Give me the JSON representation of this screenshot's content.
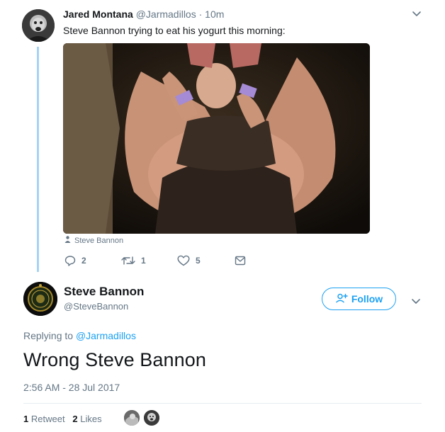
{
  "tweet1": {
    "author_name": "Jared Montana",
    "author_handle": "@Jarmadillos",
    "separator": " · ",
    "time_ago": "10m",
    "text": "Steve Bannon trying to eat his yogurt this morning:",
    "photo_tag": "Steve Bannon",
    "actions": {
      "replies": "2",
      "retweets": "1",
      "likes": "5"
    }
  },
  "tweet2": {
    "author_name": "Steve Bannon",
    "author_handle": "@SteveBannon",
    "follow_label": "Follow",
    "replying_prefix": "Replying to ",
    "replying_handle": "@Jarmadillos",
    "text": "Wrong Steve Bannon",
    "timestamp": "2:56 AM - 28 Jul 2017",
    "retweet_count": "1",
    "retweet_label": "Retweet",
    "likes_count": "2",
    "likes_label": "Likes"
  },
  "colors": {
    "accent": "#1da1f2",
    "muted": "#657786",
    "thread_line": "#a6d3f2"
  },
  "icons": [
    "reply-icon",
    "retweet-icon",
    "like-icon",
    "dm-icon",
    "chevron-down-icon",
    "person-tag-icon",
    "follow-add-icon"
  ]
}
